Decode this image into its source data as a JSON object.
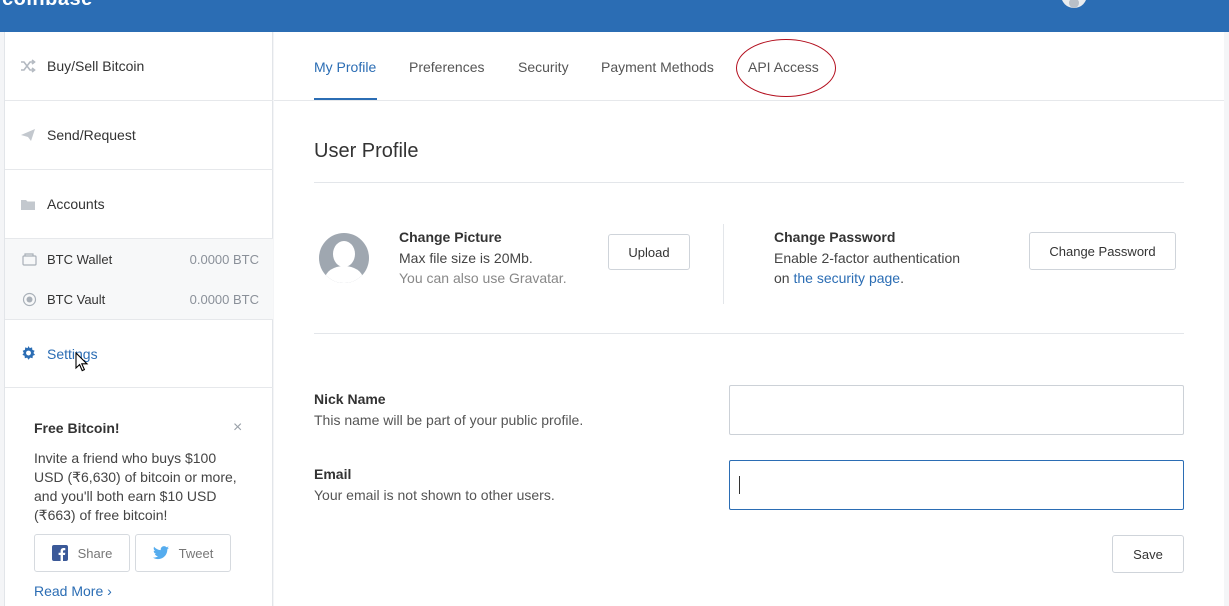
{
  "brand": "coinbase",
  "sidebar": {
    "items": [
      {
        "label": "Buy/Sell Bitcoin",
        "icon": "shuffle-icon"
      },
      {
        "label": "Send/Request",
        "icon": "paper-plane-icon"
      },
      {
        "label": "Accounts",
        "icon": "folder-icon"
      }
    ],
    "wallets": [
      {
        "label": "BTC Wallet",
        "balance": "0.0000 BTC",
        "icon": "wallet-icon"
      },
      {
        "label": "BTC Vault",
        "balance": "0.0000 BTC",
        "icon": "vault-icon"
      }
    ],
    "settings": {
      "label": "Settings",
      "icon": "gear-icon"
    }
  },
  "promo": {
    "title": "Free Bitcoin!",
    "close": "×",
    "text": "Invite a friend who buys $100 USD (₹6,630) of bitcoin or more, and you'll both earn $10 USD (₹663) of free bitcoin!",
    "share_label": "Share",
    "tweet_label": "Tweet",
    "read_more": "Read More ›"
  },
  "tabs": [
    {
      "label": "My Profile",
      "active": true
    },
    {
      "label": "Preferences"
    },
    {
      "label": "Security"
    },
    {
      "label": "Payment Methods"
    },
    {
      "label": "API Access"
    }
  ],
  "profile": {
    "section_title": "User Profile",
    "picture": {
      "title": "Change Picture",
      "line1": "Max file size is 20Mb.",
      "line2": "You can also use Gravatar.",
      "upload_label": "Upload"
    },
    "password": {
      "title": "Change Password",
      "line1": "Enable 2-factor authentication",
      "line2_prefix": "on ",
      "line2_link": "the security page",
      "line2_suffix": ".",
      "button_label": "Change Password"
    },
    "nickname": {
      "label": "Nick Name",
      "help": "This name will be part of your public profile.",
      "value": ""
    },
    "email": {
      "label": "Email",
      "help": "Your email is not shown to other users.",
      "value": ""
    },
    "save_label": "Save"
  },
  "colors": {
    "brand_blue": "#2b6db4",
    "annotation_red": "#b30f1e"
  }
}
